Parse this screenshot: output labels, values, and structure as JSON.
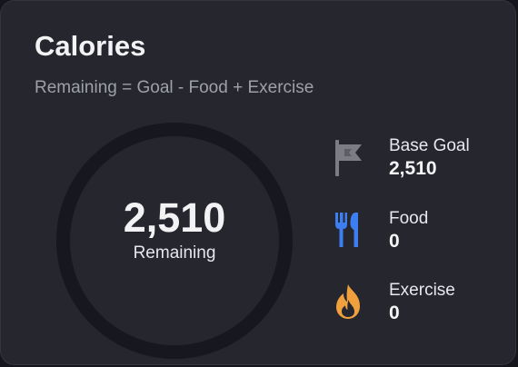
{
  "card": {
    "title": "Calories",
    "subtitle": "Remaining = Goal - Food + Exercise"
  },
  "ring": {
    "value": "2,510",
    "label": "Remaining",
    "progress": 0
  },
  "stats": [
    {
      "label": "Base Goal",
      "value": "2,510",
      "icon": "flag-icon",
      "color": "#7b7c85"
    },
    {
      "label": "Food",
      "value": "0",
      "icon": "utensils-icon",
      "color": "#3d7ff0"
    },
    {
      "label": "Exercise",
      "value": "0",
      "icon": "flame-icon",
      "color": "#f0a03c"
    }
  ]
}
